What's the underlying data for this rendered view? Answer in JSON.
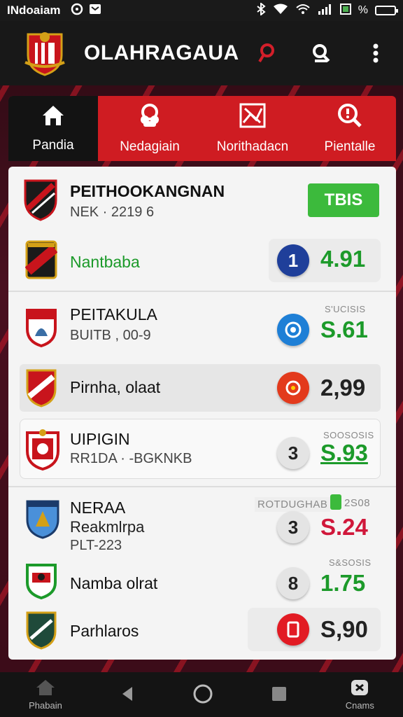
{
  "status_bar": {
    "carrier": "INdoaiam",
    "right_text": "%"
  },
  "app": {
    "title": "OLAHRAGAUA"
  },
  "tabs": [
    {
      "label": "Pandia",
      "icon": "home-icon"
    },
    {
      "label": "Nedagiain",
      "icon": "contacts-icon"
    },
    {
      "label": "Norithadacn",
      "icon": "image-icon"
    },
    {
      "label": "Pientalle",
      "icon": "search-icon"
    }
  ],
  "matches": [
    {
      "team": "PEITHOOKANGNAN",
      "sub": "NEK · 2219 6",
      "button": "TBIS"
    },
    {
      "team": "Nantbaba",
      "num": "1",
      "odds": "4.91"
    },
    {
      "team": "PEITAKULA",
      "sub": "BUITB , 00-9",
      "label": "S'UCISIS",
      "odds": "S.61"
    },
    {
      "team": "Pirnha, olaat",
      "odds": "2,99"
    },
    {
      "team": "UIPIGIN",
      "sub": "RR1DA · -BGKNKB",
      "label": "SOOSOSIS",
      "num": "3",
      "odds": "S.93"
    },
    {
      "team": "NERAA",
      "sub": "Reakmlrpa",
      "sub2": "PLT-223",
      "label": "ROTDUGHAB",
      "label_num": "2S08",
      "num": "3",
      "odds": "S.24"
    },
    {
      "team": "Namba olrat",
      "label": "S&SOSIS",
      "num": "8",
      "odds": "1.75"
    },
    {
      "team": "Parhlaros",
      "odds": "S,90"
    }
  ],
  "nav": {
    "home_label": "Phabain",
    "games_label": "Cnams"
  },
  "colors": {
    "accent": "#cf1c22",
    "green": "#1c9a2a",
    "dark": "#181818"
  }
}
